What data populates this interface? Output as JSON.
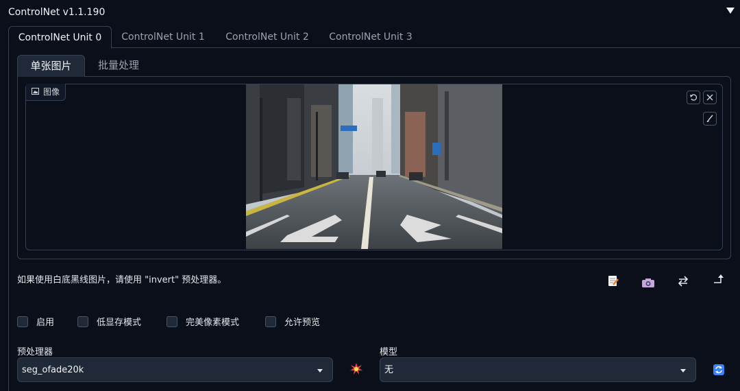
{
  "header": {
    "title": "ControlNet v1.1.190"
  },
  "unit_tabs": [
    "ControlNet Unit 0",
    "ControlNet Unit 1",
    "ControlNet Unit 2",
    "ControlNet Unit 3"
  ],
  "sub_tabs": [
    "单张图片",
    "批量处理"
  ],
  "image_panel": {
    "label": "图像",
    "icons": [
      "image-icon",
      "undo-icon",
      "close-icon",
      "brush-icon"
    ]
  },
  "hint": "如果使用白底黑线图片，请使用 \"invert\" 预处理器。",
  "tools": [
    "new-canvas-icon",
    "camera-icon",
    "swap-icon",
    "send-up-icon"
  ],
  "checkboxes": [
    {
      "label": "启用",
      "checked": false
    },
    {
      "label": "低显存模式",
      "checked": false
    },
    {
      "label": "完美像素模式",
      "checked": false
    },
    {
      "label": "允许预览",
      "checked": false
    }
  ],
  "preprocessor": {
    "label": "预处理器",
    "value": "seg_ofade20k"
  },
  "model": {
    "label": "模型",
    "value": "无"
  },
  "colors": {
    "background": "#0b0f19",
    "border": "#374151",
    "input": "#1f2937",
    "accent": "#3b82f6"
  }
}
